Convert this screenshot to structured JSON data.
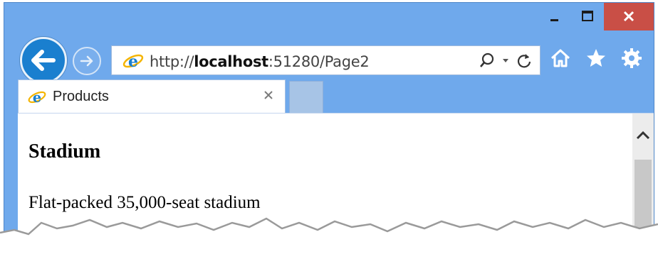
{
  "window": {
    "controls": {
      "minimize_icon": "minimize-icon",
      "maximize_icon": "maximize-icon",
      "close_icon": "close-icon"
    }
  },
  "nav": {
    "back_icon": "arrow-left-icon",
    "forward_icon": "arrow-right-icon"
  },
  "address_bar": {
    "scheme": "http://",
    "host": "localhost",
    "rest": ":51280/Page2",
    "icons": [
      "ie-logo-icon",
      "search-icon",
      "dropdown-icon",
      "refresh-icon"
    ]
  },
  "toolbar": {
    "icons": [
      "home-icon",
      "favorites-star-icon",
      "settings-gear-icon"
    ]
  },
  "tabs": [
    {
      "title": "Products",
      "active": true
    }
  ],
  "page": {
    "product_name": "Stadium",
    "product_description": "Flat-packed 35,000-seat stadium"
  },
  "colors": {
    "frame": "#6fa9ec",
    "close_button": "#c94f46",
    "back_button": "#1a7fcf",
    "new_tab": "#a7c4e6"
  }
}
